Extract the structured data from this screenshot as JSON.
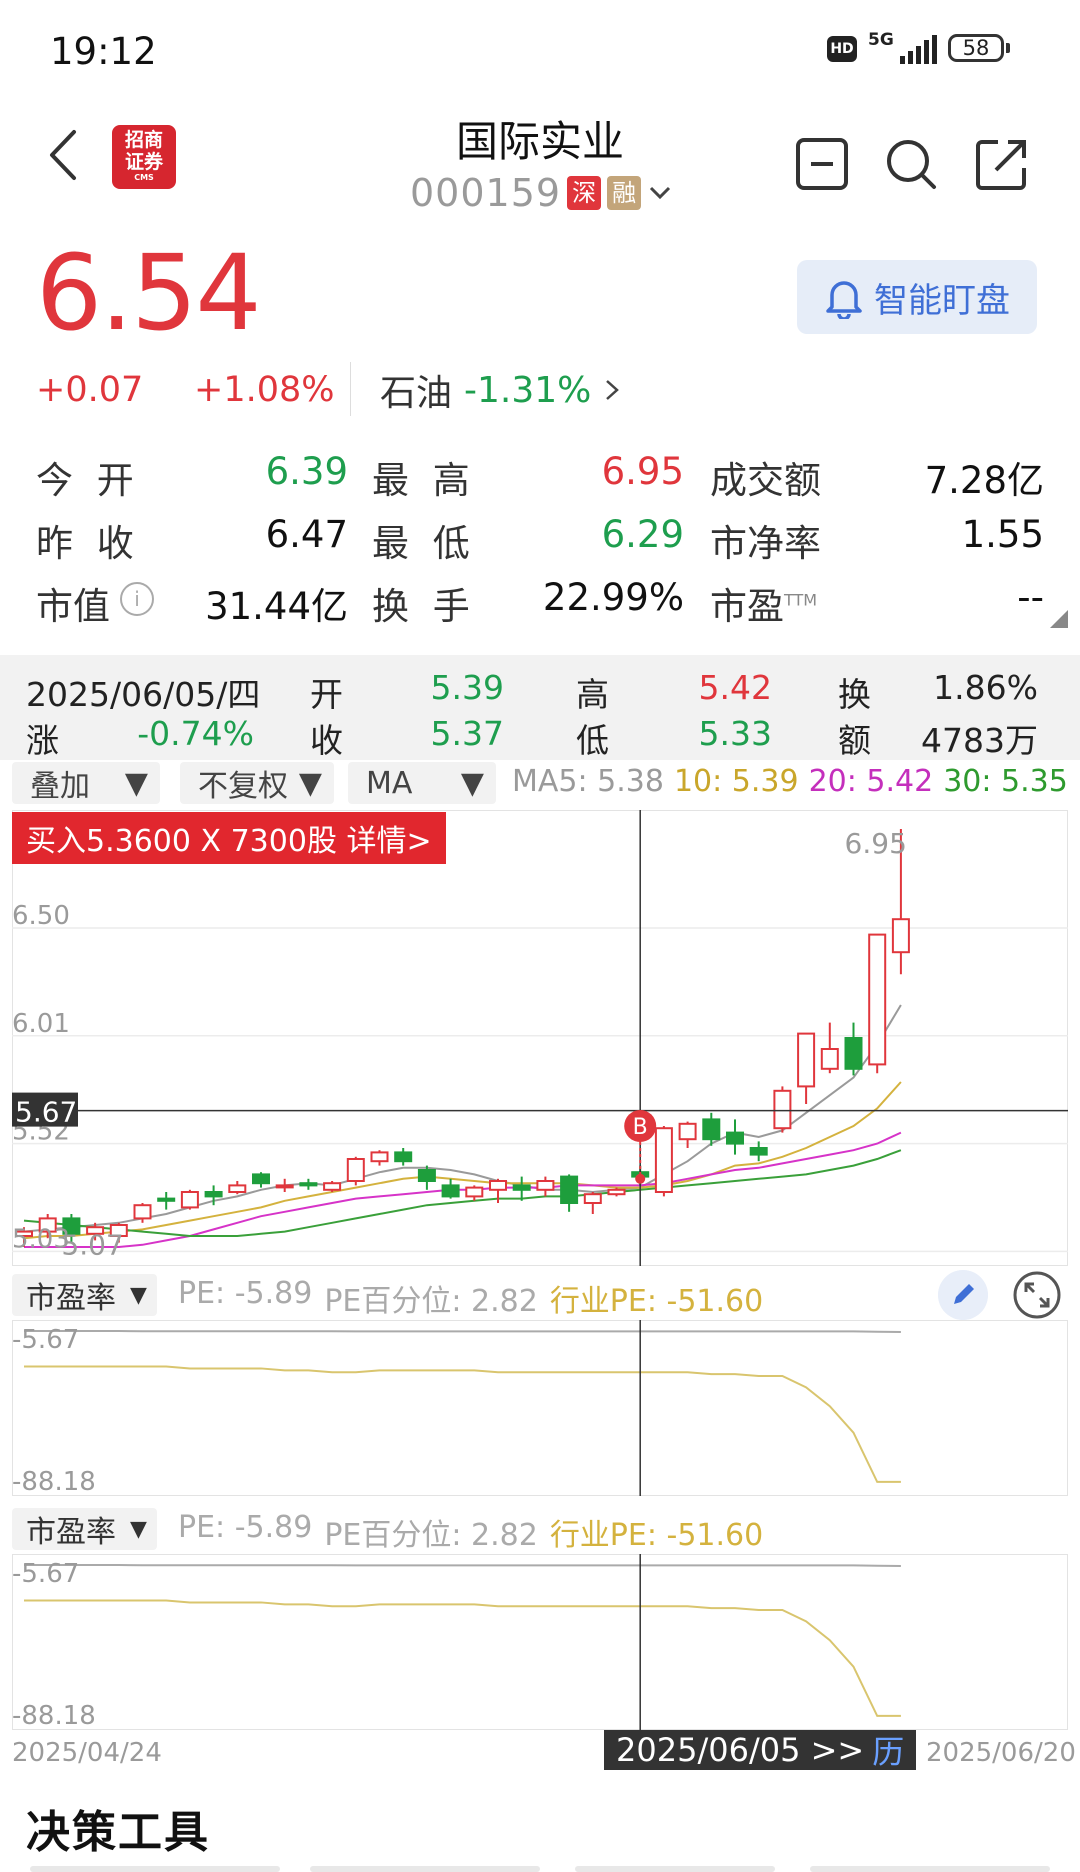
{
  "status_bar": {
    "time": "19:12",
    "hd": "HD",
    "network": "5G",
    "battery": "58"
  },
  "header": {
    "title": "国际实业",
    "code": "000159",
    "market_badge": "深",
    "margin_badge": "融",
    "logo_line1": "招商",
    "logo_line2": "证券",
    "logo_sub": "CMS"
  },
  "quote": {
    "price": "6.54",
    "change_abs": "+0.07",
    "change_pct": "+1.08%",
    "sector_name": "石油",
    "sector_pct": "-1.31%",
    "alert_label": "智能盯盘"
  },
  "stats": {
    "open_label": "今 开",
    "open": "6.39",
    "high_label": "最 高",
    "high": "6.95",
    "amount_label": "成交额",
    "amount": "7.28亿",
    "prev_close_label": "昨 收",
    "prev_close": "6.47",
    "low_label": "最 低",
    "low": "6.29",
    "pb_label": "市净率",
    "pb": "1.55",
    "mcap_label": "市值",
    "mcap": "31.44亿",
    "turnover_label": "换 手",
    "turnover": "22.99%",
    "pe_label": "市盈",
    "pe_sup": "TTM",
    "pe": "--"
  },
  "info_panel": {
    "date": "2025/06/05/四",
    "open_label": "开",
    "open": "5.39",
    "high_label": "高",
    "high": "5.42",
    "turn_label": "换",
    "turn": "1.86%",
    "chg_label": "涨",
    "chg": "-0.74%",
    "close_label": "收",
    "close": "5.37",
    "low_label": "低",
    "low": "5.33",
    "amt_label": "额",
    "amt": "4783万"
  },
  "controls": {
    "overlay": "叠加",
    "adjust": "不复权",
    "indicator": "MA",
    "ma5": "MA5: 5.38",
    "ma10": "10: 5.39",
    "ma20": "20: 5.42",
    "ma30": "30: 5.35"
  },
  "chart_data": {
    "type": "candlestick",
    "trade_banner": "买入5.3600 X 7300股 详情>",
    "marker": "B",
    "y_ticks": [
      "6.50",
      "6.01",
      "5.52",
      "5.03"
    ],
    "max_label": "6.95",
    "min_label": "5.07",
    "cross_price": "5.67",
    "ylim": [
      5.0,
      7.0
    ],
    "candles": [
      {
        "o": 5.1,
        "h": 5.14,
        "l": 5.05,
        "c": 5.12
      },
      {
        "o": 5.12,
        "h": 5.2,
        "l": 5.09,
        "c": 5.18
      },
      {
        "o": 5.18,
        "h": 5.2,
        "l": 5.07,
        "c": 5.11
      },
      {
        "o": 5.11,
        "h": 5.16,
        "l": 5.08,
        "c": 5.14
      },
      {
        "o": 5.1,
        "h": 5.16,
        "l": 5.07,
        "c": 5.15
      },
      {
        "o": 5.18,
        "h": 5.25,
        "l": 5.16,
        "c": 5.24
      },
      {
        "o": 5.27,
        "h": 5.3,
        "l": 5.22,
        "c": 5.26
      },
      {
        "o": 5.23,
        "h": 5.31,
        "l": 5.22,
        "c": 5.3
      },
      {
        "o": 5.3,
        "h": 5.33,
        "l": 5.24,
        "c": 5.28
      },
      {
        "o": 5.3,
        "h": 5.35,
        "l": 5.29,
        "c": 5.33
      },
      {
        "o": 5.38,
        "h": 5.39,
        "l": 5.32,
        "c": 5.34
      },
      {
        "o": 5.33,
        "h": 5.36,
        "l": 5.3,
        "c": 5.33
      },
      {
        "o": 5.34,
        "h": 5.36,
        "l": 5.31,
        "c": 5.33
      },
      {
        "o": 5.31,
        "h": 5.35,
        "l": 5.3,
        "c": 5.34
      },
      {
        "o": 5.35,
        "h": 5.46,
        "l": 5.33,
        "c": 5.45
      },
      {
        "o": 5.44,
        "h": 5.49,
        "l": 5.42,
        "c": 5.48
      },
      {
        "o": 5.48,
        "h": 5.5,
        "l": 5.42,
        "c": 5.44
      },
      {
        "o": 5.4,
        "h": 5.42,
        "l": 5.31,
        "c": 5.35
      },
      {
        "o": 5.33,
        "h": 5.36,
        "l": 5.27,
        "c": 5.28
      },
      {
        "o": 5.28,
        "h": 5.33,
        "l": 5.26,
        "c": 5.32
      },
      {
        "o": 5.31,
        "h": 5.36,
        "l": 5.25,
        "c": 5.35
      },
      {
        "o": 5.33,
        "h": 5.37,
        "l": 5.26,
        "c": 5.31
      },
      {
        "o": 5.31,
        "h": 5.37,
        "l": 5.28,
        "c": 5.35
      },
      {
        "o": 5.37,
        "h": 5.38,
        "l": 5.21,
        "c": 5.25
      },
      {
        "o": 5.25,
        "h": 5.3,
        "l": 5.2,
        "c": 5.29
      },
      {
        "o": 5.29,
        "h": 5.32,
        "l": 5.28,
        "c": 5.31
      },
      {
        "o": 5.39,
        "h": 5.42,
        "l": 5.33,
        "c": 5.37
      },
      {
        "o": 5.3,
        "h": 5.6,
        "l": 5.28,
        "c": 5.59
      },
      {
        "o": 5.54,
        "h": 5.62,
        "l": 5.5,
        "c": 5.61
      },
      {
        "o": 5.63,
        "h": 5.66,
        "l": 5.51,
        "c": 5.54
      },
      {
        "o": 5.57,
        "h": 5.63,
        "l": 5.47,
        "c": 5.52
      },
      {
        "o": 5.5,
        "h": 5.53,
        "l": 5.44,
        "c": 5.47
      },
      {
        "o": 5.59,
        "h": 5.78,
        "l": 5.57,
        "c": 5.76
      },
      {
        "o": 5.78,
        "h": 6.02,
        "l": 5.7,
        "c": 6.02
      },
      {
        "o": 5.86,
        "h": 6.07,
        "l": 5.84,
        "c": 5.95
      },
      {
        "o": 6.0,
        "h": 6.07,
        "l": 5.83,
        "c": 5.86
      },
      {
        "o": 5.88,
        "h": 6.47,
        "l": 5.84,
        "c": 6.47
      },
      {
        "o": 6.39,
        "h": 6.95,
        "l": 6.29,
        "c": 6.54
      }
    ],
    "ma_series": [
      {
        "name": "MA5",
        "color": "#9a9a9a",
        "values": [
          5.12,
          5.13,
          5.14,
          5.15,
          5.16,
          5.18,
          5.2,
          5.23,
          5.26,
          5.28,
          5.31,
          5.33,
          5.34,
          5.33,
          5.36,
          5.39,
          5.41,
          5.41,
          5.4,
          5.38,
          5.35,
          5.33,
          5.31,
          5.31,
          5.3,
          5.31,
          5.32,
          5.38,
          5.44,
          5.52,
          5.57,
          5.55,
          5.58,
          5.66,
          5.74,
          5.82,
          5.97,
          6.15
        ]
      },
      {
        "name": "10",
        "color": "#d4b23e",
        "values": [
          5.09,
          5.1,
          5.1,
          5.11,
          5.12,
          5.13,
          5.15,
          5.17,
          5.19,
          5.21,
          5.23,
          5.26,
          5.28,
          5.3,
          5.32,
          5.34,
          5.36,
          5.37,
          5.36,
          5.35,
          5.34,
          5.34,
          5.34,
          5.34,
          5.33,
          5.32,
          5.32,
          5.33,
          5.35,
          5.38,
          5.42,
          5.43,
          5.46,
          5.5,
          5.55,
          5.6,
          5.68,
          5.8
        ]
      },
      {
        "name": "20",
        "color": "#d633c8",
        "values": [
          5.05,
          5.05,
          5.05,
          5.05,
          5.05,
          5.06,
          5.08,
          5.1,
          5.13,
          5.16,
          5.19,
          5.21,
          5.23,
          5.25,
          5.27,
          5.28,
          5.29,
          5.3,
          5.31,
          5.31,
          5.32,
          5.32,
          5.32,
          5.33,
          5.33,
          5.33,
          5.33,
          5.34,
          5.36,
          5.38,
          5.4,
          5.41,
          5.43,
          5.45,
          5.47,
          5.49,
          5.52,
          5.57
        ]
      },
      {
        "name": "30",
        "color": "#3aa03a",
        "values": [
          5.17,
          5.16,
          5.15,
          5.14,
          5.13,
          5.12,
          5.11,
          5.1,
          5.1,
          5.1,
          5.11,
          5.12,
          5.14,
          5.16,
          5.18,
          5.2,
          5.22,
          5.24,
          5.25,
          5.26,
          5.27,
          5.27,
          5.28,
          5.28,
          5.29,
          5.3,
          5.31,
          5.32,
          5.33,
          5.34,
          5.35,
          5.36,
          5.37,
          5.38,
          5.4,
          5.42,
          5.45,
          5.49
        ]
      }
    ],
    "pe_panels": [
      {
        "select": "市盈率",
        "pe": "PE: -5.89",
        "pe_pct": "PE百分位: 2.82",
        "industry_pe": "行业PE: -51.60",
        "top": "-5.67",
        "bottom": "-88.18",
        "pe_values": [
          -6.2,
          -6.2,
          -6.2,
          -6.2,
          -6.2,
          -6.3,
          -6.3,
          -6.3,
          -6.3,
          -6.3,
          -6.3,
          -6.3,
          -6.3,
          -6.3,
          -6.4,
          -6.4,
          -6.4,
          -6.4,
          -6.4,
          -6.4,
          -6.4,
          -6.4,
          -6.4,
          -6.4,
          -6.4,
          -6.4,
          -6.4,
          -6.4,
          -6.4,
          -6.4,
          -6.4,
          -6.4,
          -6.4,
          -6.4,
          -6.4,
          -6.4,
          -6.6,
          -6.7
        ],
        "industry_values": [
          -25,
          -25,
          -25,
          -25,
          -25,
          -25,
          -25,
          -26,
          -26,
          -26,
          -26,
          -27,
          -27,
          -28,
          -28,
          -27,
          -27,
          -27,
          -27,
          -27,
          -28,
          -28,
          -28,
          -28,
          -28,
          -28,
          -28,
          -28,
          -28,
          -29,
          -29,
          -30,
          -30,
          -36,
          -46,
          -60,
          -86,
          -86
        ]
      },
      {
        "select": "市盈率",
        "pe": "PE: -5.89",
        "pe_pct": "PE百分位: 2.82",
        "industry_pe": "行业PE: -51.60",
        "top": "-5.67",
        "bottom": "-88.18",
        "pe_values": [
          -6.2,
          -6.2,
          -6.2,
          -6.2,
          -6.2,
          -6.3,
          -6.3,
          -6.3,
          -6.3,
          -6.3,
          -6.3,
          -6.3,
          -6.3,
          -6.3,
          -6.4,
          -6.4,
          -6.4,
          -6.4,
          -6.4,
          -6.4,
          -6.4,
          -6.4,
          -6.4,
          -6.4,
          -6.4,
          -6.4,
          -6.4,
          -6.4,
          -6.4,
          -6.4,
          -6.4,
          -6.4,
          -6.4,
          -6.4,
          -6.4,
          -6.4,
          -6.6,
          -6.7
        ],
        "industry_values": [
          -25,
          -25,
          -25,
          -25,
          -25,
          -25,
          -25,
          -26,
          -26,
          -26,
          -26,
          -27,
          -27,
          -28,
          -28,
          -27,
          -27,
          -27,
          -27,
          -27,
          -28,
          -28,
          -28,
          -28,
          -28,
          -28,
          -28,
          -28,
          -28,
          -29,
          -29,
          -30,
          -30,
          -36,
          -46,
          -60,
          -86,
          -86
        ]
      }
    ],
    "x_start": "2025/04/24",
    "x_cross": "2025/06/05 >>",
    "x_hist": "历",
    "x_end": "2025/06/20"
  },
  "footer": {
    "decision_tools": "决策工具"
  }
}
